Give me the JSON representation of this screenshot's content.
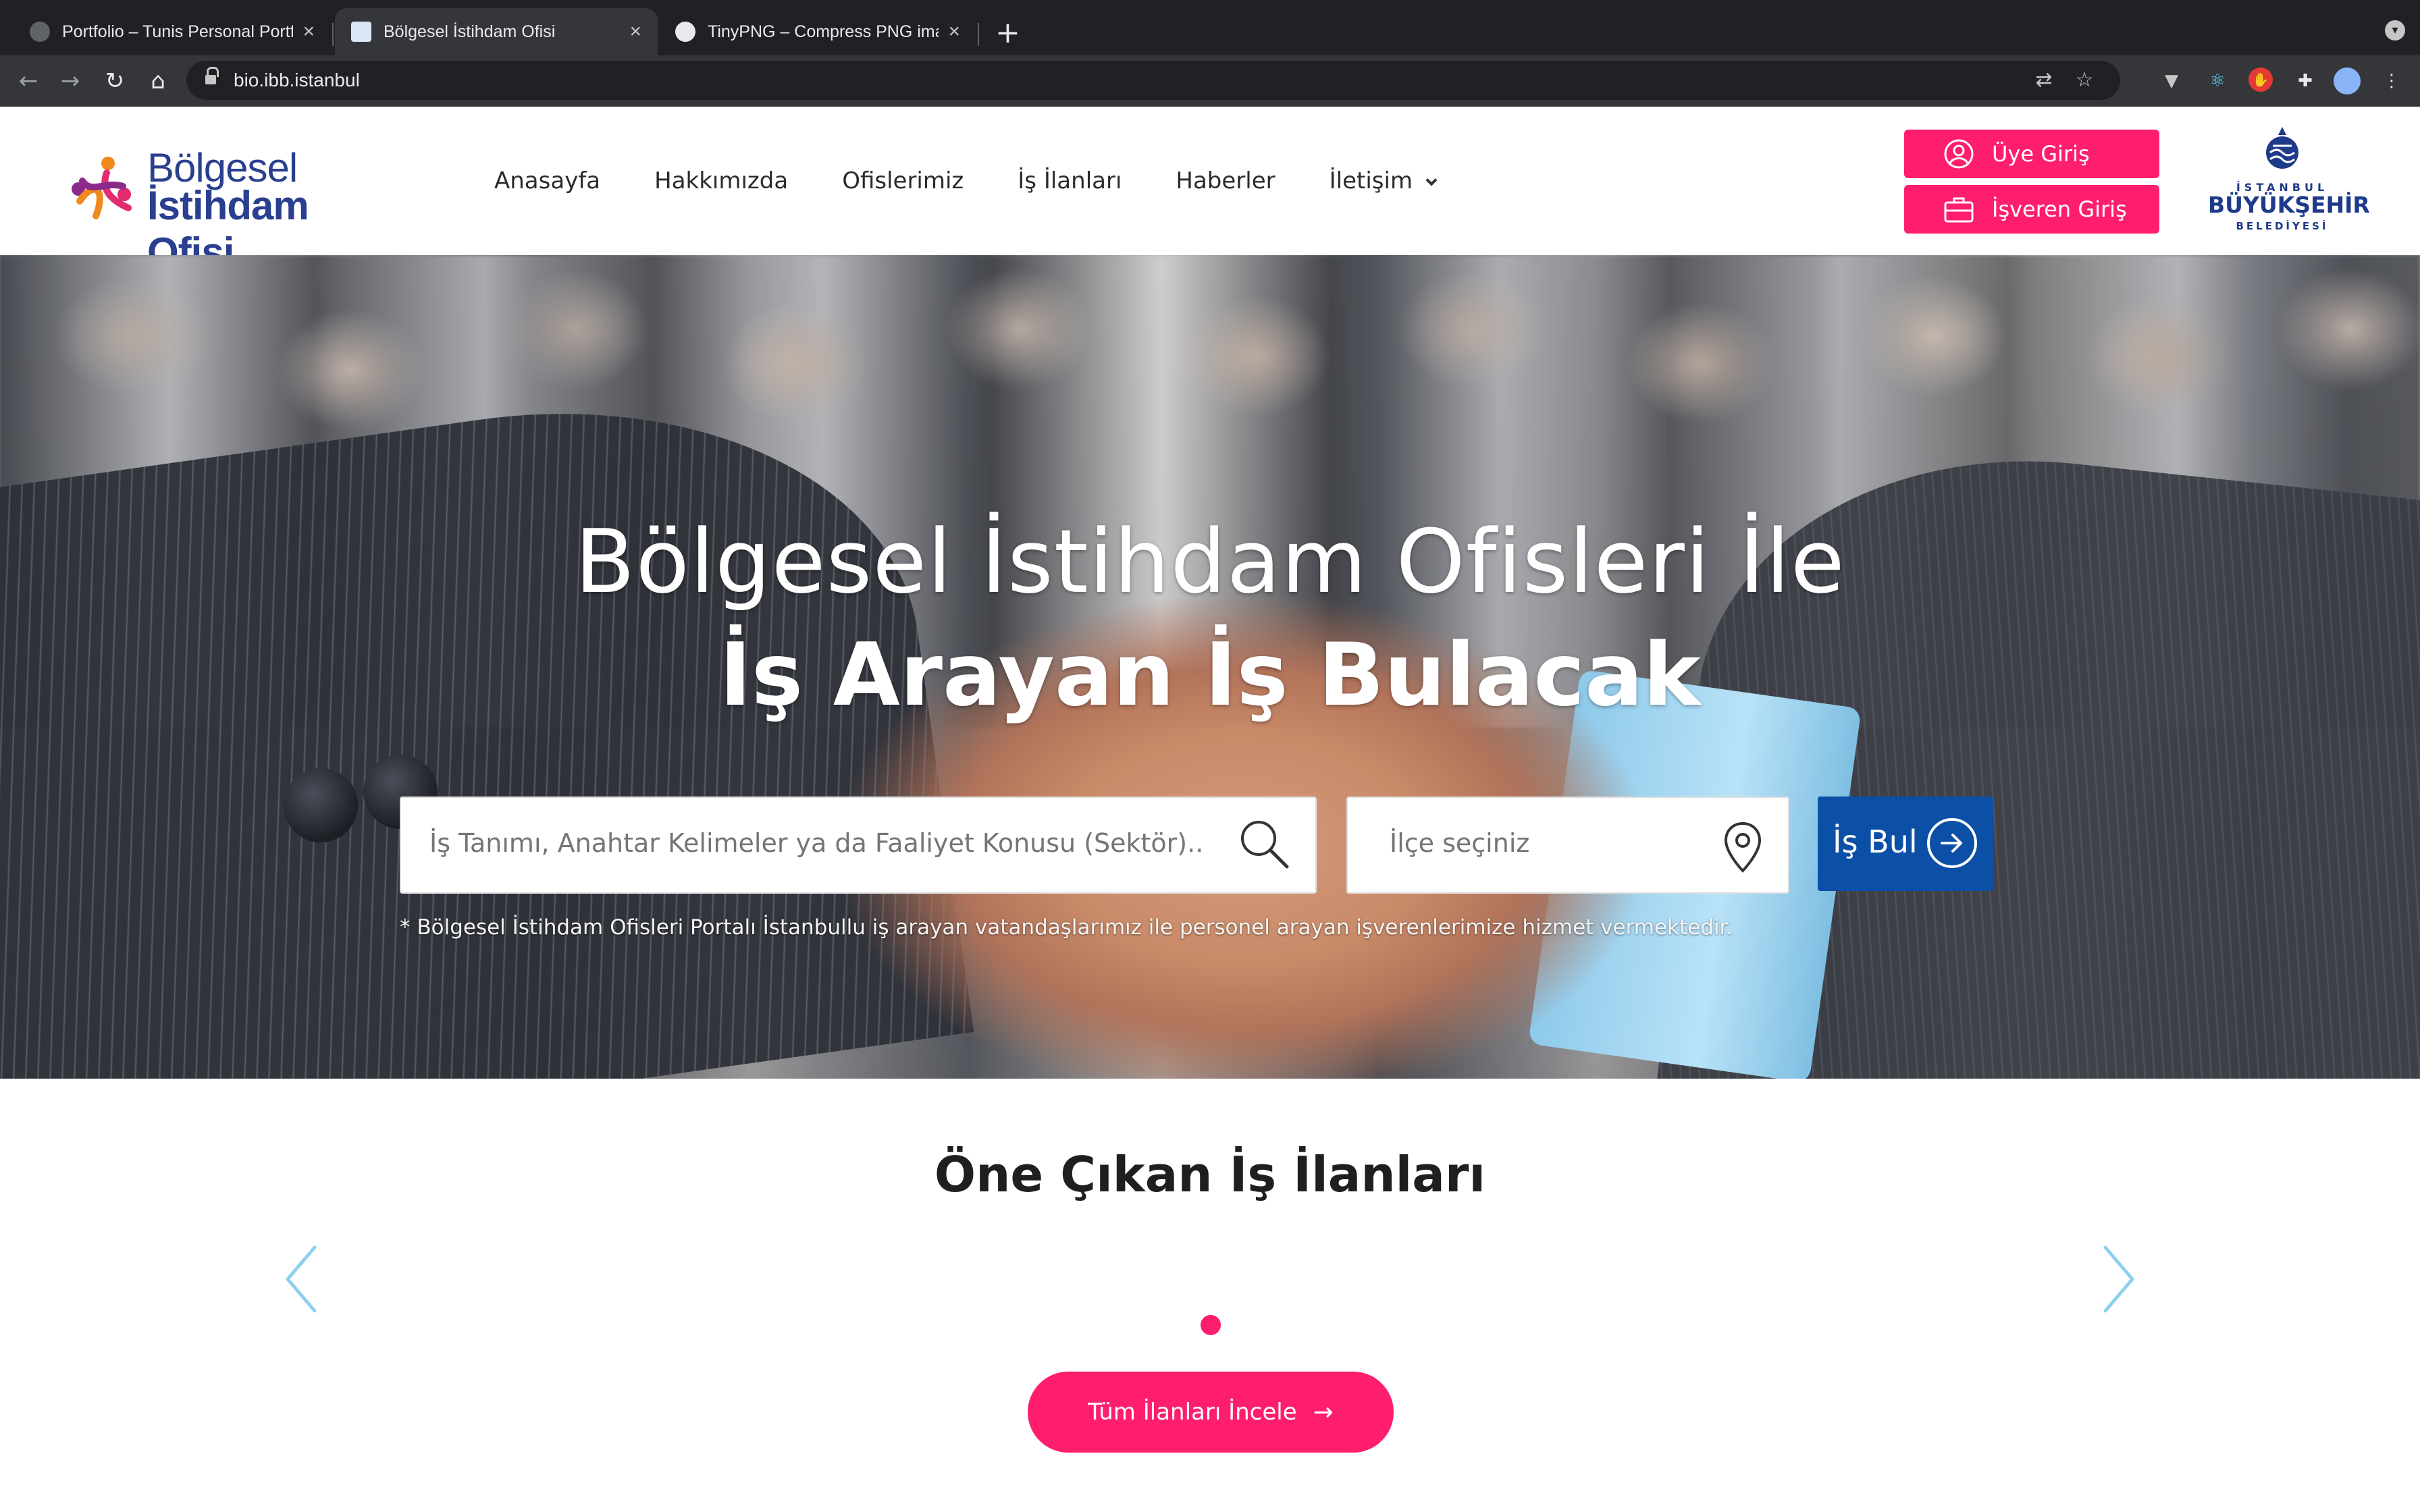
{
  "browser": {
    "tabs": [
      {
        "title": "Portfolio – Tunis Personal Portfo"
      },
      {
        "title": "Bölgesel İstihdam Ofisi"
      },
      {
        "title": "TinyPNG – Compress PNG ima"
      }
    ],
    "new_tab": "+",
    "url": "bio.ibb.istanbul"
  },
  "header": {
    "logo_line1": "Bölgesel",
    "logo_line2": "İstihdam Ofisi",
    "nav": [
      "Anasayfa",
      "Hakkımızda",
      "Ofislerimiz",
      "İş İlanları",
      "Haberler",
      "İletişim"
    ],
    "member_login": "Üye Giriş",
    "employer_login": "İşveren Giriş",
    "ibb_line1": "İSTANBUL",
    "ibb_line2": "BÜYÜKŞEHİR",
    "ibb_line3": "BELEDİYESİ"
  },
  "hero": {
    "title_line1": "Bölgesel İstihdam Ofisleri İle",
    "title_line2": "İş Arayan İş Bulacak",
    "search_placeholder": "İş Tanımı, Anahtar Kelimeler ya da Faaliyet Konusu (Sektör)...",
    "district_placeholder": "İlçe seçiniz",
    "find_button": "İş Bul",
    "note": "* Bölgesel İstihdam Ofisleri Portalı İstanbullu iş arayan vatandaşlarımız ile personel arayan işverenlerimize hizmet vermektedir."
  },
  "featured": {
    "title": "Öne Çıkan İş İlanları",
    "all_button": "Tüm İlanları İncele"
  },
  "colors": {
    "accent": "#ff1e6d",
    "primary": "#0b4fa6",
    "logo_blue": "#2a3f8f",
    "chrome_dark": "#202124"
  }
}
